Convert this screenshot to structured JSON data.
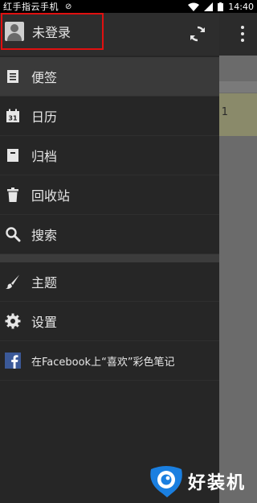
{
  "status_bar": {
    "carrier": "红手指云手机",
    "time": "14:40"
  },
  "drawer": {
    "account_label": "未登录",
    "items": [
      {
        "label": "便签",
        "icon": "note-icon",
        "active": true
      },
      {
        "label": "日历",
        "icon": "calendar-icon",
        "active": false
      },
      {
        "label": "归档",
        "icon": "archive-icon",
        "active": false
      },
      {
        "label": "回收站",
        "icon": "trash-icon",
        "active": false
      },
      {
        "label": "搜索",
        "icon": "search-icon",
        "active": false
      }
    ],
    "settings_items": [
      {
        "label": "主题",
        "icon": "brush-icon"
      },
      {
        "label": "设置",
        "icon": "gear-icon"
      },
      {
        "label": "在Facebook上“喜欢”彩色笔记",
        "icon": "facebook-icon"
      }
    ]
  },
  "background": {
    "note_text": "1"
  },
  "watermark": {
    "text": "好装机"
  },
  "colors": {
    "drawer_bg": "#262626",
    "highlight_border": "#e01010",
    "facebook_blue": "#3b5998",
    "watermark_blue": "#1a7fe0"
  }
}
